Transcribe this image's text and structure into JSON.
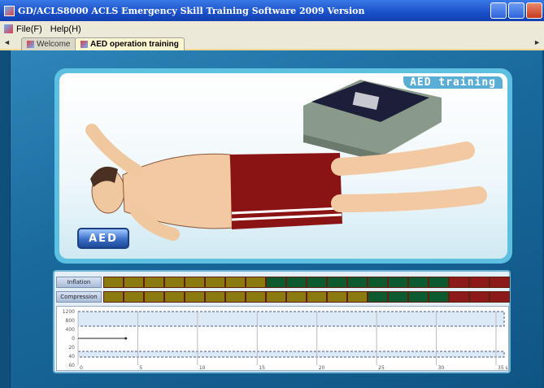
{
  "window": {
    "title": "GD/ACLS8000 ACLS Emergency Skill Training Software 2009 Version"
  },
  "menu": [
    {
      "label": "File(F)"
    },
    {
      "label": "Help(H)"
    }
  ],
  "tabs": [
    {
      "label": "Welcome",
      "active": false
    },
    {
      "label": "AED operation training",
      "active": true
    }
  ],
  "scene": {
    "title": "AED  training",
    "aed_button_label": "AED"
  },
  "meters": {
    "inflation": {
      "label": "Inflation",
      "segments": [
        "olive",
        "olive",
        "olive",
        "olive",
        "olive",
        "olive",
        "olive",
        "olive",
        "green",
        "green",
        "green",
        "green",
        "green",
        "green",
        "green",
        "green",
        "green",
        "red",
        "red",
        "red"
      ]
    },
    "compression": {
      "label": "Compression",
      "segments": [
        "olive",
        "olive",
        "olive",
        "olive",
        "olive",
        "olive",
        "olive",
        "olive",
        "olive",
        "olive",
        "olive",
        "olive",
        "olive",
        "green",
        "green",
        "green",
        "green",
        "red",
        "red",
        "red"
      ]
    }
  },
  "colors": {
    "olive": "#8a7a10",
    "green": "#0e5a30",
    "red": "#8c1a1a"
  },
  "chart_data": {
    "type": "line",
    "y_ticks": [
      "1200",
      "800",
      "400",
      "0",
      "20",
      "40",
      "60"
    ],
    "x_ticks": [
      "0",
      "5",
      "10",
      "15",
      "20",
      "25",
      "30",
      "35 sec"
    ],
    "series": [
      {
        "x": [
          0,
          4
        ],
        "y": [
          0,
          0
        ]
      }
    ]
  }
}
